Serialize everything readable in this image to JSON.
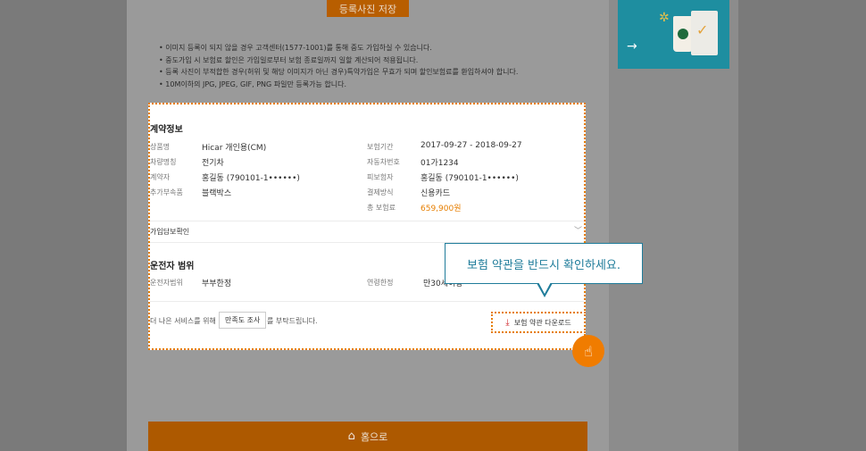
{
  "save_photo_label": "등록사진 저장",
  "notes": [
    "이미지 등록이 되지 않을 경우 고객센터(1577-1001)를 통해 중도 가입하실 수 있습니다.",
    "중도가입 시 보험료 할인은 가입일로부터 보험 종료일까지 일할 계산되어 적용됩니다.",
    "등록 사진이 부적합한 경우(허위 및 해당 이미지가 아닌 경우)특약가입은 무효가 되며 할인보험료를 환입하셔야 합니다.",
    "10M이하의 JPG, JPEG, GIF, PNG 파일만 등록가능 합니다."
  ],
  "contract": {
    "title": "계약정보",
    "left": [
      {
        "label": "상품명",
        "value": "Hicar 개인용(CM)"
      },
      {
        "label": "차량명칭",
        "value": "전기차"
      },
      {
        "label": "계약자",
        "value": "홍길동 (790101-1••••••)"
      },
      {
        "label": "추가부속품",
        "value": "블랙박스"
      }
    ],
    "right": [
      {
        "label": "보험기간",
        "value": "2017-09-27 - 2018-09-27"
      },
      {
        "label": "자동차번호",
        "value": "01가1234"
      },
      {
        "label": "피보험자",
        "value": "홍길동 (790101-1••••••)"
      },
      {
        "label": "결제방식",
        "value": "신용카드"
      },
      {
        "label": "총 보험료",
        "value": "659,900원"
      }
    ]
  },
  "coverage": {
    "title": "가입담보확인",
    "chevron": "﹀"
  },
  "driver": {
    "title": "운전자 범위",
    "range_label": "운전자범위",
    "range_value": "부부한정",
    "age_label": "연령한정",
    "age_value": "만30세이상"
  },
  "survey": {
    "prefix": "더 나은 서비스를 위해",
    "button": "만족도 조사",
    "suffix": "를 부탁드립니다."
  },
  "download_label": "보험 약관 다운로드",
  "tooltip": "보험 약관을 반드시 확인하세요.",
  "home_label": "홈으로",
  "colors": {
    "accent": "#e67e00",
    "tooltip": "#1f7c9a",
    "home_bg": "#ad5900"
  }
}
